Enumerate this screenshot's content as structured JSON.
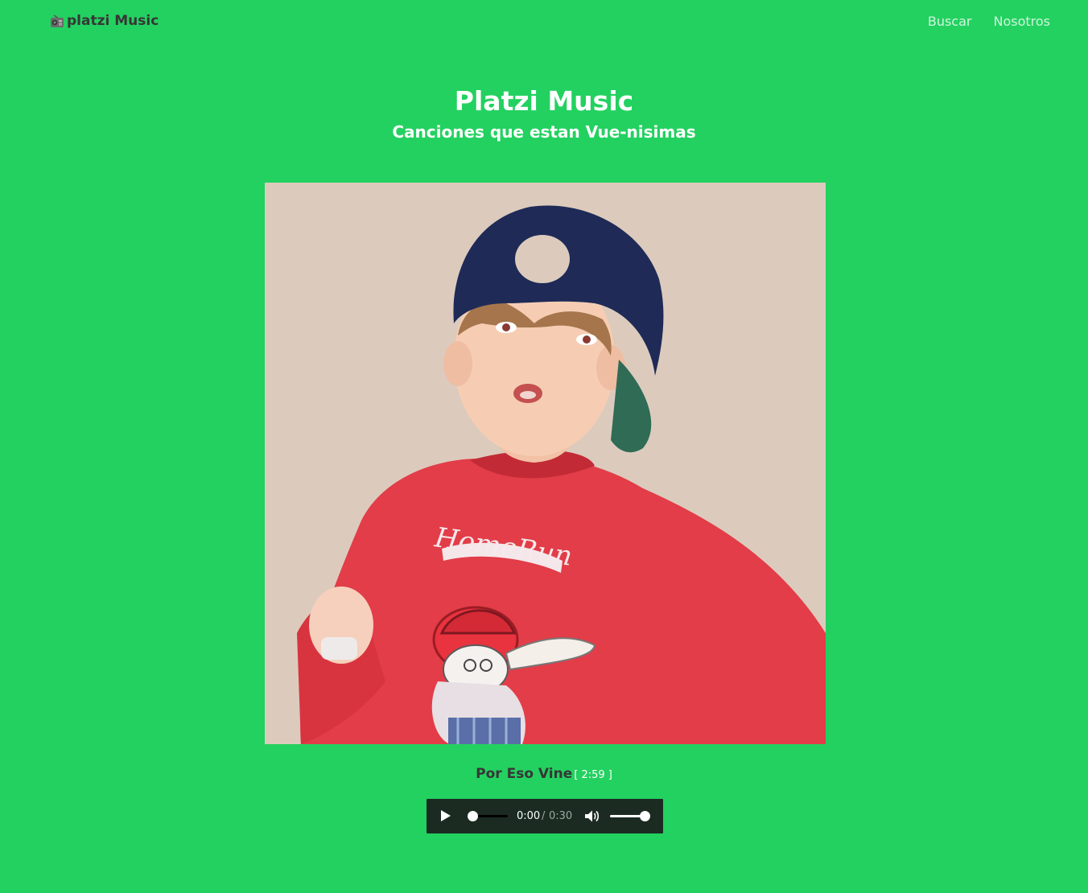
{
  "navbar": {
    "brand_icon": "radio-icon",
    "brand_label": "platzi Music",
    "links": [
      {
        "label": "Buscar"
      },
      {
        "label": "Nosotros"
      }
    ]
  },
  "hero": {
    "title": "Platzi Music",
    "subtitle": "Canciones que estan Vue-nisimas"
  },
  "album": {
    "image_icon": "album-art-photo",
    "printed_text": "HomeRun"
  },
  "track": {
    "name": "Por Eso Vine",
    "duration": "[ 2:59 ]"
  },
  "player": {
    "play_icon": "play-icon",
    "current_time": "0:00",
    "separator": "/",
    "total_time": "0:30",
    "progress": 0.0,
    "volume_icon": "volume-icon",
    "volume": 1.0
  },
  "colors": {
    "background": "#23d160",
    "brand_text": "#363636",
    "player_bg": "#1b2b22"
  }
}
